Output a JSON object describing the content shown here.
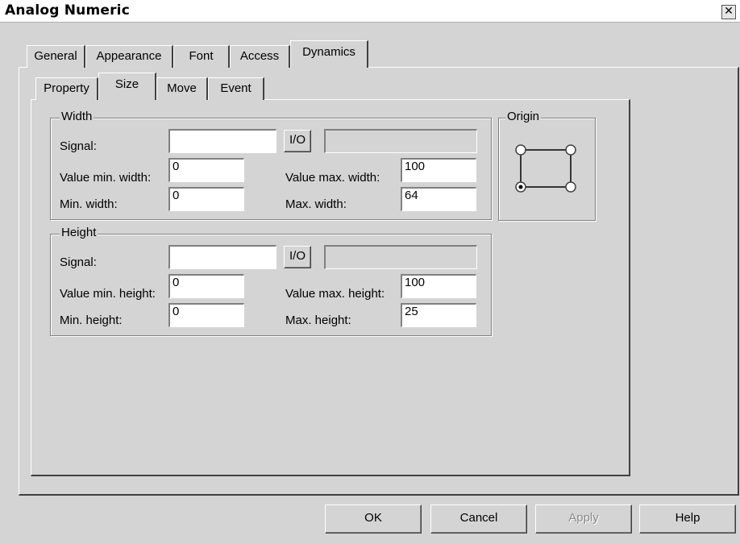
{
  "window": {
    "title": "Analog Numeric",
    "close_glyph": "✕"
  },
  "tabs": [
    "General",
    "Appearance",
    "Font",
    "Access",
    "Dynamics"
  ],
  "active_tab": "Dynamics",
  "subtabs": [
    "Property",
    "Size",
    "Move",
    "Event"
  ],
  "active_subtab": "Size",
  "width_group": {
    "legend": "Width",
    "signal_label": "Signal:",
    "signal_value": "",
    "io_label": "I/O",
    "signal_address": "",
    "value_min_label": "Value min. width:",
    "value_min": "0",
    "value_max_label": "Value max. width:",
    "value_max": "100",
    "min_label": "Min. width:",
    "min": "0",
    "max_label": "Max. width:",
    "max": "64"
  },
  "height_group": {
    "legend": "Height",
    "signal_label": "Signal:",
    "signal_value": "",
    "io_label": "I/O",
    "signal_address": "",
    "value_min_label": "Value min. height:",
    "value_min": "0",
    "value_max_label": "Value max. height:",
    "value_max": "100",
    "min_label": "Min. height:",
    "min": "0",
    "max_label": "Max. height:",
    "max": "25"
  },
  "origin": {
    "legend": "Origin",
    "selected": "bottom-left",
    "options": [
      "top-left",
      "top-right",
      "bottom-left",
      "bottom-right"
    ]
  },
  "buttons": {
    "ok": "OK",
    "cancel": "Cancel",
    "apply": "Apply",
    "help": "Help"
  },
  "colors": {
    "background": "#d4d4d4",
    "titlebar": "#ffffff",
    "field": "#ffffff",
    "disabled_text": "#8a8a8a"
  }
}
